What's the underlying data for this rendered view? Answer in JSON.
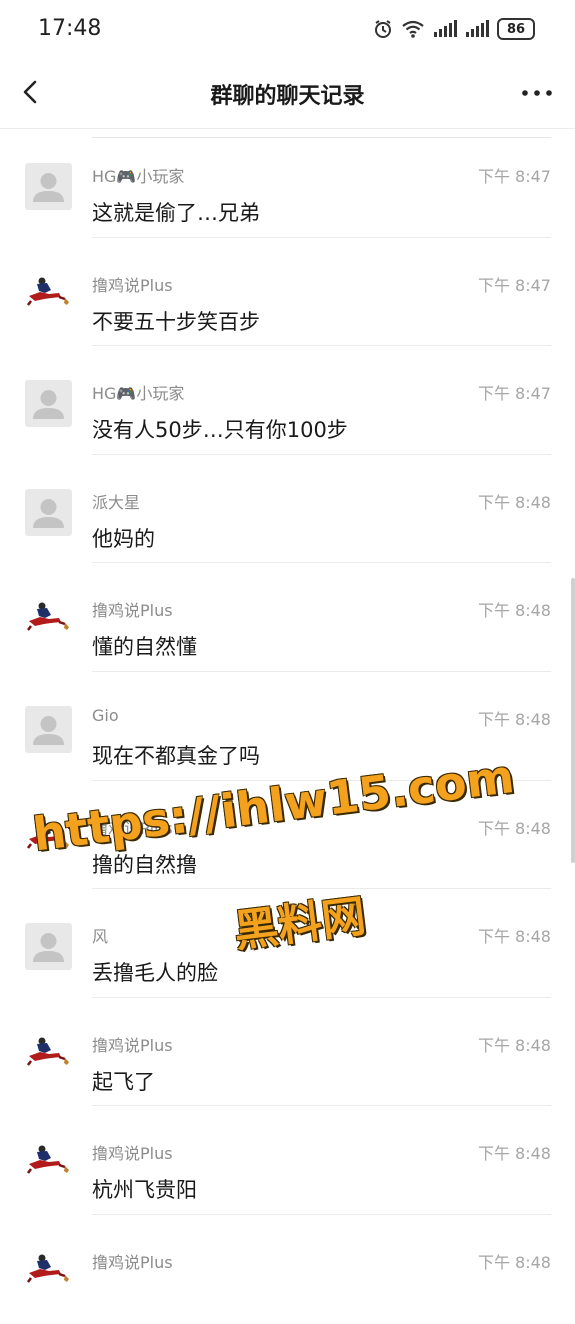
{
  "status_bar": {
    "time": "17:48",
    "battery": "86"
  },
  "header": {
    "title": "群聊的聊天记录"
  },
  "messages": [
    {
      "sender": "HG🎮小玩家",
      "time": "下午 8:47",
      "text": "这就是偷了…兄弟",
      "avatar": "default"
    },
    {
      "sender": "撸鸡说Plus",
      "time": "下午 8:47",
      "text": "不要五十步笑百步",
      "avatar": "photo"
    },
    {
      "sender": "HG🎮小玩家",
      "time": "下午 8:47",
      "text": "没有人50步…只有你100步",
      "avatar": "default"
    },
    {
      "sender": "派大星",
      "time": "下午 8:48",
      "text": "他妈的",
      "avatar": "default"
    },
    {
      "sender": "撸鸡说Plus",
      "time": "下午 8:48",
      "text": "懂的自然懂",
      "avatar": "photo"
    },
    {
      "sender": "Gio",
      "time": "下午 8:48",
      "text": "现在不都真金了吗",
      "avatar": "default"
    },
    {
      "sender": "撸鸡说Plus",
      "time": "下午 8:48",
      "text": "撸的自然撸",
      "avatar": "photo"
    },
    {
      "sender": "风",
      "time": "下午 8:48",
      "text": "丢撸毛人的脸",
      "avatar": "default"
    },
    {
      "sender": "撸鸡说Plus",
      "time": "下午 8:48",
      "text": "起飞了",
      "avatar": "photo"
    },
    {
      "sender": "撸鸡说Plus",
      "time": "下午 8:48",
      "text": "杭州飞贵阳",
      "avatar": "photo"
    },
    {
      "sender": "撸鸡说Plus",
      "time": "下午 8:48",
      "text": "",
      "avatar": "photo"
    }
  ],
  "watermark": {
    "line1": "https://ihlw15.com",
    "line2": "黑料网"
  },
  "icons": {
    "back": "back-arrow-icon",
    "more": "more-dots-icon",
    "default_avatar": "default-user-icon"
  },
  "colors": {
    "watermark": "#f4a21e",
    "sender": "#8c8c8c",
    "time": "#a6a6a6"
  }
}
